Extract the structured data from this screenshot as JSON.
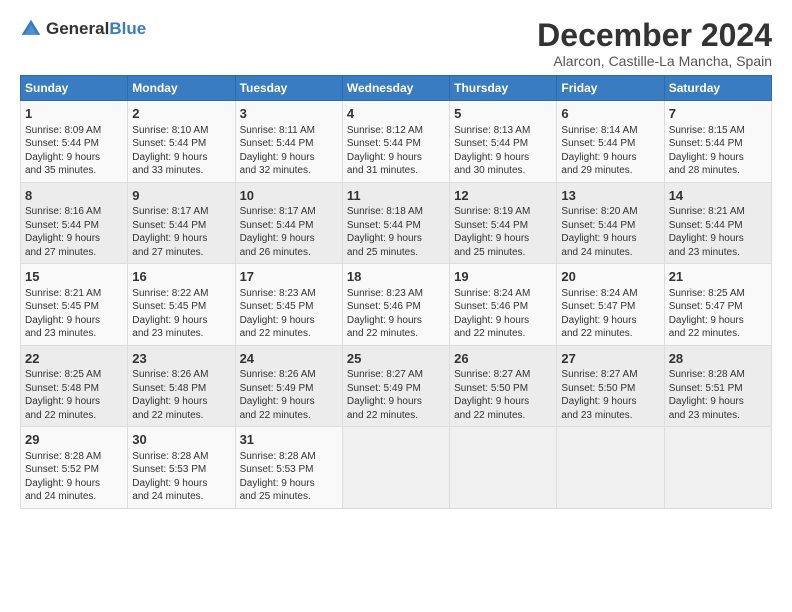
{
  "logo": {
    "text1": "General",
    "text2": "Blue"
  },
  "title": "December 2024",
  "subtitle": "Alarcon, Castille-La Mancha, Spain",
  "days_of_week": [
    "Sunday",
    "Monday",
    "Tuesday",
    "Wednesday",
    "Thursday",
    "Friday",
    "Saturday"
  ],
  "weeks": [
    [
      {
        "day": "1",
        "lines": [
          "Sunrise: 8:09 AM",
          "Sunset: 5:44 PM",
          "Daylight: 9 hours",
          "and 35 minutes."
        ]
      },
      {
        "day": "2",
        "lines": [
          "Sunrise: 8:10 AM",
          "Sunset: 5:44 PM",
          "Daylight: 9 hours",
          "and 33 minutes."
        ]
      },
      {
        "day": "3",
        "lines": [
          "Sunrise: 8:11 AM",
          "Sunset: 5:44 PM",
          "Daylight: 9 hours",
          "and 32 minutes."
        ]
      },
      {
        "day": "4",
        "lines": [
          "Sunrise: 8:12 AM",
          "Sunset: 5:44 PM",
          "Daylight: 9 hours",
          "and 31 minutes."
        ]
      },
      {
        "day": "5",
        "lines": [
          "Sunrise: 8:13 AM",
          "Sunset: 5:44 PM",
          "Daylight: 9 hours",
          "and 30 minutes."
        ]
      },
      {
        "day": "6",
        "lines": [
          "Sunrise: 8:14 AM",
          "Sunset: 5:44 PM",
          "Daylight: 9 hours",
          "and 29 minutes."
        ]
      },
      {
        "day": "7",
        "lines": [
          "Sunrise: 8:15 AM",
          "Sunset: 5:44 PM",
          "Daylight: 9 hours",
          "and 28 minutes."
        ]
      }
    ],
    [
      {
        "day": "8",
        "lines": [
          "Sunrise: 8:16 AM",
          "Sunset: 5:44 PM",
          "Daylight: 9 hours",
          "and 27 minutes."
        ]
      },
      {
        "day": "9",
        "lines": [
          "Sunrise: 8:17 AM",
          "Sunset: 5:44 PM",
          "Daylight: 9 hours",
          "and 27 minutes."
        ]
      },
      {
        "day": "10",
        "lines": [
          "Sunrise: 8:17 AM",
          "Sunset: 5:44 PM",
          "Daylight: 9 hours",
          "and 26 minutes."
        ]
      },
      {
        "day": "11",
        "lines": [
          "Sunrise: 8:18 AM",
          "Sunset: 5:44 PM",
          "Daylight: 9 hours",
          "and 25 minutes."
        ]
      },
      {
        "day": "12",
        "lines": [
          "Sunrise: 8:19 AM",
          "Sunset: 5:44 PM",
          "Daylight: 9 hours",
          "and 25 minutes."
        ]
      },
      {
        "day": "13",
        "lines": [
          "Sunrise: 8:20 AM",
          "Sunset: 5:44 PM",
          "Daylight: 9 hours",
          "and 24 minutes."
        ]
      },
      {
        "day": "14",
        "lines": [
          "Sunrise: 8:21 AM",
          "Sunset: 5:44 PM",
          "Daylight: 9 hours",
          "and 23 minutes."
        ]
      }
    ],
    [
      {
        "day": "15",
        "lines": [
          "Sunrise: 8:21 AM",
          "Sunset: 5:45 PM",
          "Daylight: 9 hours",
          "and 23 minutes."
        ]
      },
      {
        "day": "16",
        "lines": [
          "Sunrise: 8:22 AM",
          "Sunset: 5:45 PM",
          "Daylight: 9 hours",
          "and 23 minutes."
        ]
      },
      {
        "day": "17",
        "lines": [
          "Sunrise: 8:23 AM",
          "Sunset: 5:45 PM",
          "Daylight: 9 hours",
          "and 22 minutes."
        ]
      },
      {
        "day": "18",
        "lines": [
          "Sunrise: 8:23 AM",
          "Sunset: 5:46 PM",
          "Daylight: 9 hours",
          "and 22 minutes."
        ]
      },
      {
        "day": "19",
        "lines": [
          "Sunrise: 8:24 AM",
          "Sunset: 5:46 PM",
          "Daylight: 9 hours",
          "and 22 minutes."
        ]
      },
      {
        "day": "20",
        "lines": [
          "Sunrise: 8:24 AM",
          "Sunset: 5:47 PM",
          "Daylight: 9 hours",
          "and 22 minutes."
        ]
      },
      {
        "day": "21",
        "lines": [
          "Sunrise: 8:25 AM",
          "Sunset: 5:47 PM",
          "Daylight: 9 hours",
          "and 22 minutes."
        ]
      }
    ],
    [
      {
        "day": "22",
        "lines": [
          "Sunrise: 8:25 AM",
          "Sunset: 5:48 PM",
          "Daylight: 9 hours",
          "and 22 minutes."
        ]
      },
      {
        "day": "23",
        "lines": [
          "Sunrise: 8:26 AM",
          "Sunset: 5:48 PM",
          "Daylight: 9 hours",
          "and 22 minutes."
        ]
      },
      {
        "day": "24",
        "lines": [
          "Sunrise: 8:26 AM",
          "Sunset: 5:49 PM",
          "Daylight: 9 hours",
          "and 22 minutes."
        ]
      },
      {
        "day": "25",
        "lines": [
          "Sunrise: 8:27 AM",
          "Sunset: 5:49 PM",
          "Daylight: 9 hours",
          "and 22 minutes."
        ]
      },
      {
        "day": "26",
        "lines": [
          "Sunrise: 8:27 AM",
          "Sunset: 5:50 PM",
          "Daylight: 9 hours",
          "and 22 minutes."
        ]
      },
      {
        "day": "27",
        "lines": [
          "Sunrise: 8:27 AM",
          "Sunset: 5:50 PM",
          "Daylight: 9 hours",
          "and 23 minutes."
        ]
      },
      {
        "day": "28",
        "lines": [
          "Sunrise: 8:28 AM",
          "Sunset: 5:51 PM",
          "Daylight: 9 hours",
          "and 23 minutes."
        ]
      }
    ],
    [
      {
        "day": "29",
        "lines": [
          "Sunrise: 8:28 AM",
          "Sunset: 5:52 PM",
          "Daylight: 9 hours",
          "and 24 minutes."
        ]
      },
      {
        "day": "30",
        "lines": [
          "Sunrise: 8:28 AM",
          "Sunset: 5:53 PM",
          "Daylight: 9 hours",
          "and 24 minutes."
        ]
      },
      {
        "day": "31",
        "lines": [
          "Sunrise: 8:28 AM",
          "Sunset: 5:53 PM",
          "Daylight: 9 hours",
          "and 25 minutes."
        ]
      },
      null,
      null,
      null,
      null
    ]
  ]
}
